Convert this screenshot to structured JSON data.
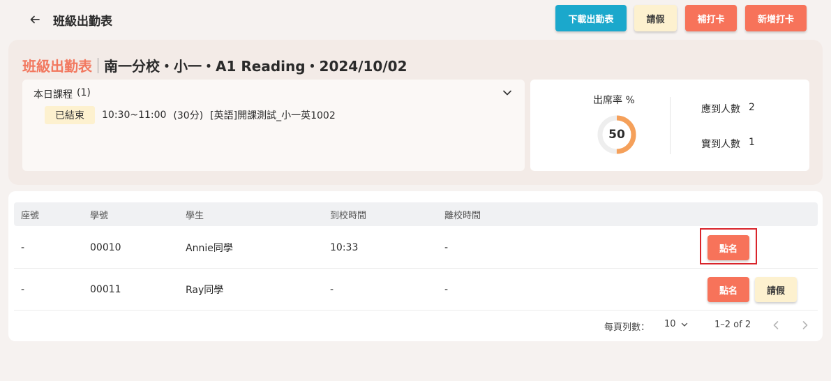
{
  "header": {
    "title": "班級出勤表",
    "buttons": {
      "download": "下載出勤表",
      "leave": "請假",
      "makeup": "補打卡",
      "new_punch": "新增打卡"
    }
  },
  "summary": {
    "heading_accent": "班級出勤表",
    "heading_main": "南一分校・小一・A1 Reading・2024/10/02",
    "course": {
      "title": "本日課程",
      "count": "(1)",
      "status": "已結束",
      "time": "10:30~11:00",
      "duration": "(30分)",
      "name": "[英語]開課測試_小一英1002"
    },
    "stats": {
      "rate_label": "出席率 %",
      "rate_value": "50",
      "rate_fraction": 0.5,
      "expected_label": "應到人數",
      "expected_value": "2",
      "actual_label": "實到人數",
      "actual_value": "1"
    }
  },
  "table": {
    "columns": [
      "座號",
      "學號",
      "學生",
      "到校時間",
      "離校時間"
    ],
    "rows": [
      {
        "seat": "-",
        "id": "00010",
        "student": "Annie同學",
        "arrive": "10:33",
        "leave": "-",
        "roll_label": "點名"
      },
      {
        "seat": "-",
        "id": "00011",
        "student": "Ray同學",
        "arrive": "-",
        "leave": "-",
        "roll_label": "點名",
        "leave_label": "請假"
      }
    ]
  },
  "pagination": {
    "rows_per_page_label": "每頁列數：",
    "rows_per_page": "10",
    "range": "1–2 of 2"
  },
  "colors": {
    "accent": "#f2785f",
    "primary_button": "#f7735a",
    "download_button": "#1ba8cc",
    "soft_button": "#fdf1cf",
    "gauge_fill": "#f5a05a",
    "highlight": "#d9252b"
  },
  "icons": {
    "back": "arrow-left-icon",
    "expand": "chevron-down-icon",
    "select": "chevron-down-icon",
    "prev": "chevron-left-icon",
    "next": "chevron-right-icon"
  }
}
